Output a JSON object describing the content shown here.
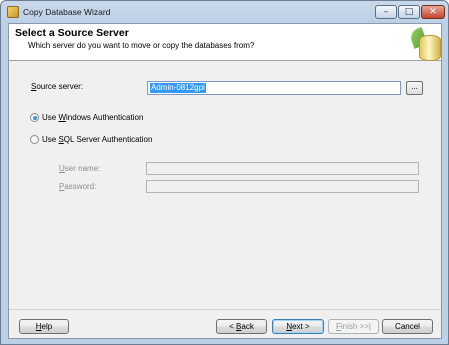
{
  "window": {
    "title": "Copy Database Wizard",
    "minimize_glyph": "–",
    "maximize_glyph": "□",
    "close_glyph": "✕"
  },
  "header": {
    "title": "Select a Source Server",
    "subtitle": "Which server do you want to move or copy the databases from?"
  },
  "source_server": {
    "label_pre": "",
    "label_key": "S",
    "label_post": "ource server:",
    "value": "Admin-0812gpi",
    "browse_label": "..."
  },
  "auth": {
    "windows": {
      "pre": "Use ",
      "key": "W",
      "post": "indows Authentication",
      "checked": true
    },
    "sql": {
      "pre": "Use ",
      "key": "S",
      "post": "QL Server Authentication",
      "checked": false
    }
  },
  "credentials": {
    "user_name_label": {
      "pre": "",
      "key": "U",
      "post": "ser name:"
    },
    "password_label": {
      "pre": "",
      "key": "P",
      "post": "assword:"
    },
    "user_name_value": "",
    "password_value": ""
  },
  "buttons": {
    "help": {
      "pre": "",
      "key": "H",
      "post": "elp"
    },
    "back": {
      "pre": "< ",
      "key": "B",
      "post": "ack"
    },
    "next": {
      "pre": "",
      "key": "N",
      "post": "ext >"
    },
    "finish": {
      "pre": "",
      "key": "F",
      "post": "inish >>|"
    },
    "cancel": {
      "pre": "Cancel",
      "key": "",
      "post": ""
    }
  }
}
